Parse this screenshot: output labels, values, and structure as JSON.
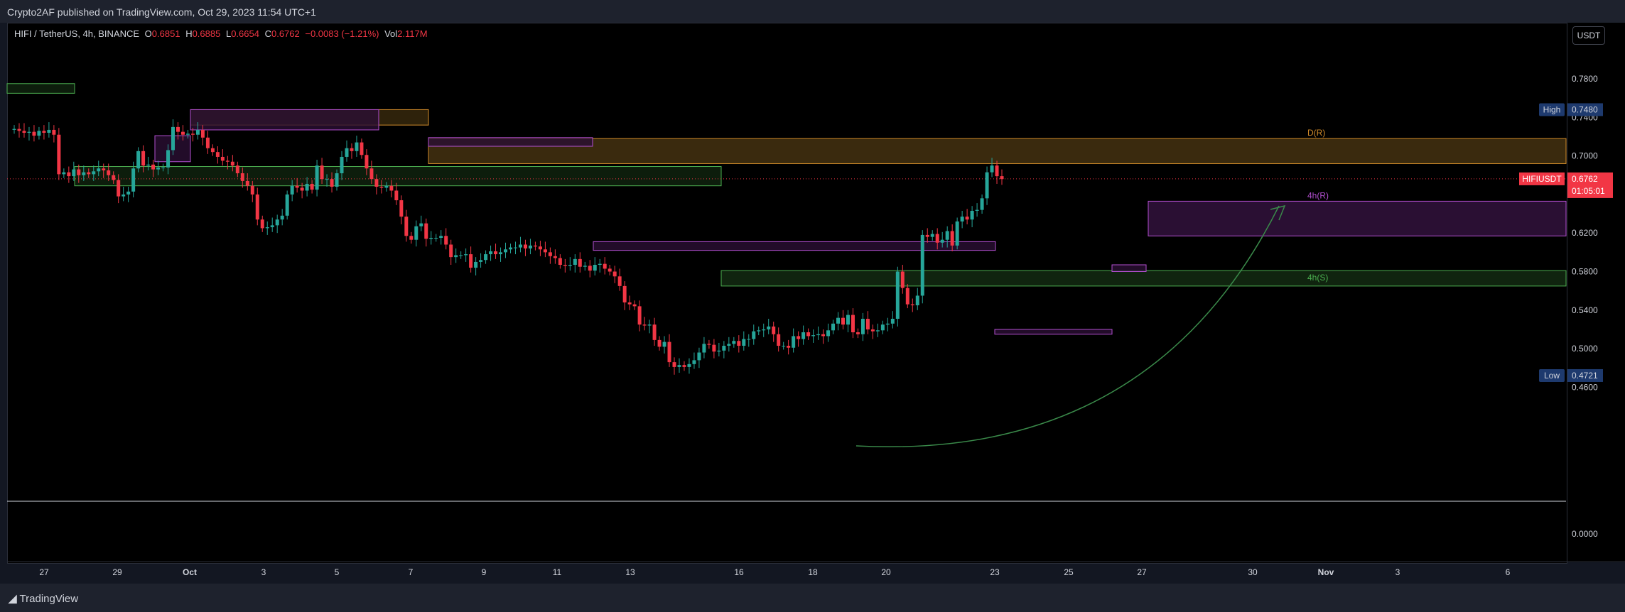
{
  "header": {
    "published_text": "Crypto2AF published on TradingView.com, Oct 29, 2023 11:54 UTC+1"
  },
  "legend": {
    "symbol": "HIFI / TetherUS, 4h, BINANCE",
    "o_label": "O",
    "o_value": "0.6851",
    "h_label": "H",
    "h_value": "0.6885",
    "l_label": "L",
    "l_value": "0.6654",
    "c_label": "C",
    "c_value": "0.6762",
    "change": "−0.0083 (−1.21%)",
    "vol_label": "Vol",
    "vol_value": "2.117M"
  },
  "currency_button": "USDT",
  "footer": {
    "brand": "TradingView"
  },
  "colors": {
    "up": "#22ab94",
    "down": "#f23645",
    "up_bright": "#26d98f",
    "supply_fill": "#3d2e10",
    "supply_border": "#d18b2a",
    "fvg_border": "#b24fd0",
    "demand_border": "#4caf50",
    "curve": "#3a8a4a"
  },
  "chart_data": {
    "type": "candlestick",
    "symbol": "HIFIUSDT",
    "timeframe": "4h",
    "exchange": "BINANCE",
    "ylim": [
      0.44,
      0.79
    ],
    "y_ticks": [
      "0.7800",
      "0.7400",
      "0.7000",
      "0.6600",
      "0.6200",
      "0.5800",
      "0.5400",
      "0.5000",
      "0.4600"
    ],
    "volume_pane_tick": "0.0000",
    "x_ticks": [
      "27",
      "29",
      "Oct",
      "3",
      "5",
      "7",
      "9",
      "11",
      "13",
      "16",
      "18",
      "20",
      "23",
      "25",
      "27",
      "30",
      "Nov",
      "3",
      "6"
    ],
    "price_labels": {
      "high_label": "High",
      "high_value": "0.7480",
      "low_label": "Low",
      "low_value": "0.4721",
      "last_label": "HIFIUSDT",
      "last_value": "0.6762",
      "countdown": "01:05:01"
    },
    "zones": [
      {
        "label": "D(R)",
        "kind": "supply",
        "top": 0.718,
        "bottom": 0.692
      },
      {
        "label": "4h(R)",
        "kind": "resistance",
        "top": 0.653,
        "bottom": 0.617
      },
      {
        "label": "4h(S)",
        "kind": "support",
        "top": 0.581,
        "bottom": 0.565
      }
    ],
    "closes": [
      0.728,
      0.726,
      0.724,
      0.725,
      0.721,
      0.726,
      0.724,
      0.727,
      0.722,
      0.681,
      0.683,
      0.679,
      0.686,
      0.68,
      0.683,
      0.681,
      0.684,
      0.687,
      0.685,
      0.68,
      0.675,
      0.658,
      0.66,
      0.663,
      0.687,
      0.705,
      0.69,
      0.691,
      0.686,
      0.688,
      0.688,
      0.706,
      0.73,
      0.725,
      0.722,
      0.723,
      0.722,
      0.727,
      0.719,
      0.708,
      0.704,
      0.699,
      0.695,
      0.694,
      0.69,
      0.682,
      0.674,
      0.669,
      0.66,
      0.634,
      0.625,
      0.626,
      0.628,
      0.634,
      0.638,
      0.66,
      0.669,
      0.667,
      0.664,
      0.671,
      0.665,
      0.69,
      0.676,
      0.676,
      0.668,
      0.682,
      0.699,
      0.708,
      0.705,
      0.714,
      0.701,
      0.687,
      0.676,
      0.668,
      0.667,
      0.669,
      0.664,
      0.654,
      0.637,
      0.617,
      0.613,
      0.627,
      0.63,
      0.614,
      0.615,
      0.615,
      0.617,
      0.608,
      0.595,
      0.597,
      0.597,
      0.598,
      0.584,
      0.59,
      0.592,
      0.598,
      0.601,
      0.598,
      0.6,
      0.603,
      0.605,
      0.605,
      0.608,
      0.604,
      0.607,
      0.606,
      0.603,
      0.6,
      0.596,
      0.594,
      0.587,
      0.586,
      0.587,
      0.593,
      0.585,
      0.586,
      0.581,
      0.587,
      0.588,
      0.583,
      0.58,
      0.575,
      0.565,
      0.548,
      0.546,
      0.544,
      0.525,
      0.524,
      0.525,
      0.509,
      0.502,
      0.507,
      0.486,
      0.481,
      0.483,
      0.481,
      0.484,
      0.488,
      0.496,
      0.505,
      0.504,
      0.497,
      0.498,
      0.503,
      0.505,
      0.508,
      0.503,
      0.51,
      0.51,
      0.518,
      0.519,
      0.52,
      0.523,
      0.515,
      0.503,
      0.503,
      0.501,
      0.513,
      0.51,
      0.517,
      0.513,
      0.514,
      0.515,
      0.513,
      0.519,
      0.526,
      0.532,
      0.525,
      0.535,
      0.517,
      0.515,
      0.531,
      0.52,
      0.518,
      0.519,
      0.525,
      0.526,
      0.531,
      0.58,
      0.563,
      0.546,
      0.545,
      0.555,
      0.618,
      0.616,
      0.619,
      0.61,
      0.613,
      0.622,
      0.607,
      0.632,
      0.637,
      0.634,
      0.643,
      0.644,
      0.656,
      0.683,
      0.69,
      0.679,
      0.676
    ]
  }
}
